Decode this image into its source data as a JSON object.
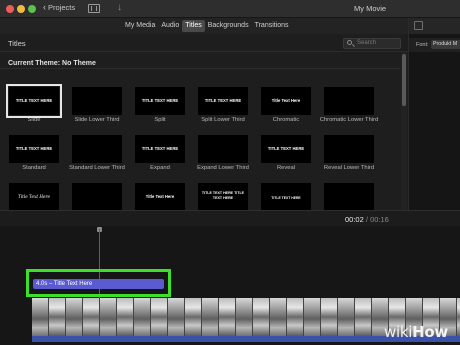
{
  "window": {
    "back_label": "Projects",
    "title": "My Movie"
  },
  "tabs": [
    {
      "label": "My Media",
      "active": false
    },
    {
      "label": "Audio",
      "active": false
    },
    {
      "label": "Titles",
      "active": true
    },
    {
      "label": "Backgrounds",
      "active": false
    },
    {
      "label": "Transitions",
      "active": false
    }
  ],
  "browser": {
    "title": "Titles",
    "search_placeholder": "Search",
    "theme_label": "Current Theme: No Theme",
    "tiles": [
      {
        "label": "Slide",
        "thumb_text": "TITLE TEXT HERE",
        "style": "plain",
        "selected": true
      },
      {
        "label": "Slide Lower Third",
        "thumb_text": "",
        "style": "plain",
        "selected": false
      },
      {
        "label": "Split",
        "thumb_text": "TITLE TEXT HERE",
        "style": "plain",
        "selected": false
      },
      {
        "label": "Split Lower Third",
        "thumb_text": "TITLE TEXT HERE",
        "style": "plain",
        "selected": false
      },
      {
        "label": "Chromatic",
        "thumb_text": "Title Text Here",
        "style": "plain",
        "selected": false
      },
      {
        "label": "Chromatic Lower Third",
        "thumb_text": "",
        "style": "plain",
        "selected": false
      },
      {
        "label": "Standard",
        "thumb_text": "TITLE TEXT HERE",
        "style": "plain",
        "selected": false
      },
      {
        "label": "Standard Lower Third",
        "thumb_text": "",
        "style": "plain",
        "selected": false
      },
      {
        "label": "Expand",
        "thumb_text": "TITLE TEXT HERE",
        "style": "plain",
        "selected": false
      },
      {
        "label": "Expand Lower Third",
        "thumb_text": "",
        "style": "plain",
        "selected": false
      },
      {
        "label": "Reveal",
        "thumb_text": "TITLE TEXT HERE",
        "style": "plain",
        "selected": false
      },
      {
        "label": "Reveal Lower Third",
        "thumb_text": "",
        "style": "plain",
        "selected": false
      },
      {
        "label": "",
        "thumb_text": "Title Text Here",
        "style": "script",
        "selected": false
      },
      {
        "label": "",
        "thumb_text": "",
        "style": "plain",
        "selected": false
      },
      {
        "label": "",
        "thumb_text": "Title Text Here",
        "style": "plain",
        "selected": false
      },
      {
        "label": "",
        "thumb_text": "TITLE TEXT HERE TITLE TEXT HERE",
        "style": "stack",
        "selected": false
      },
      {
        "label": "",
        "thumb_text": "TITLE TEXT HERE",
        "style": "small",
        "selected": false
      },
      {
        "label": "",
        "thumb_text": "",
        "style": "plain",
        "selected": false
      }
    ]
  },
  "viewer": {
    "font_label": "Font:",
    "font_value": "Produkt M"
  },
  "timeline": {
    "current_time": "00:02",
    "separator": "/",
    "duration": "00:16",
    "title_clip_label": "4.0s – Title Text Here",
    "highlight_color": "#3cdf2a",
    "title_clip_color": "#5a5bd0"
  },
  "watermark": {
    "part1": "wiki",
    "part2": "How"
  }
}
